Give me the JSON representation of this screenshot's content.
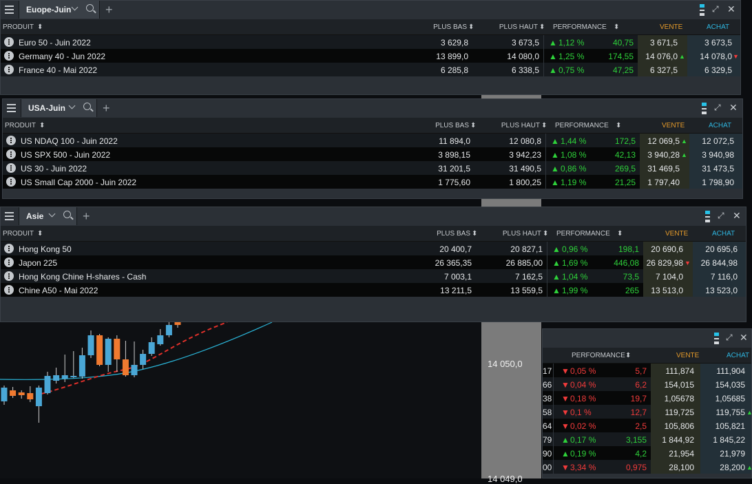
{
  "panels": {
    "europe": {
      "tab": "Euope-Juin",
      "headers": {
        "produit": "PRODUIT",
        "plus_bas": "PLUS BAS",
        "plus_haut": "PLUS HAUT",
        "performance": "PERFORMANCE",
        "vente": "VENTE",
        "achat": "ACHAT"
      },
      "rows": [
        {
          "name": "Euro 50 - Juin 2022",
          "plus_bas": "3 629,8",
          "plus_haut": "3 673,5",
          "perf": "1,12 %",
          "perf_dir": "up",
          "chg": "40,75",
          "vente": "3 671,5",
          "vente_mark": "",
          "achat": "3 673,5",
          "achat_mark": ""
        },
        {
          "name": "Germany 40 - Jun 2022",
          "plus_bas": "13 899,0",
          "plus_haut": "14 080,0",
          "perf": "1,25 %",
          "perf_dir": "up",
          "chg": "174,55",
          "vente": "14 076,0",
          "vente_mark": "up",
          "achat": "14 078,0",
          "achat_mark": "dn"
        },
        {
          "name": "France 40 - Mai 2022",
          "plus_bas": "6 285,8",
          "plus_haut": "6 338,5",
          "perf": "0,75 %",
          "perf_dir": "up",
          "chg": "47,25",
          "vente": "6 327,5",
          "vente_mark": "",
          "achat": "6 329,5",
          "achat_mark": ""
        }
      ]
    },
    "usa": {
      "tab": "USA-Juin",
      "headers": {
        "produit": "PRODUIT",
        "plus_bas": "PLUS BAS",
        "plus_haut": "PLUS HAUT",
        "performance": "PERFORMANCE",
        "vente": "VENTE",
        "achat": "ACHAT"
      },
      "rows": [
        {
          "name": "US NDAQ 100 - Juin 2022",
          "plus_bas": "11 894,0",
          "plus_haut": "12 080,8",
          "perf": "1,44 %",
          "perf_dir": "up",
          "chg": "172,5",
          "vente": "12 069,5",
          "vente_mark": "up",
          "achat": "12 072,5",
          "achat_mark": ""
        },
        {
          "name": "US SPX 500 - Juin 2022",
          "plus_bas": "3 898,15",
          "plus_haut": "3 942,23",
          "perf": "1,08 %",
          "perf_dir": "up",
          "chg": "42,13",
          "vente": "3 940,28",
          "vente_mark": "up",
          "achat": "3 940,98",
          "achat_mark": ""
        },
        {
          "name": "US 30 - Juin 2022",
          "plus_bas": "31 201,5",
          "plus_haut": "31 490,5",
          "perf": "0,86 %",
          "perf_dir": "up",
          "chg": "269,5",
          "vente": "31 469,5",
          "vente_mark": "",
          "achat": "31 473,5",
          "achat_mark": ""
        },
        {
          "name": "US Small Cap 2000 - Juin 2022",
          "plus_bas": "1 775,60",
          "plus_haut": "1 800,25",
          "perf": "1,19 %",
          "perf_dir": "up",
          "chg": "21,25",
          "vente": "1 797,40",
          "vente_mark": "",
          "achat": "1 798,90",
          "achat_mark": ""
        }
      ]
    },
    "asie": {
      "tab": "Asie",
      "headers": {
        "produit": "PRODUIT",
        "plus_bas": "PLUS BAS",
        "plus_haut": "PLUS HAUT",
        "performance": "PERFORMANCE",
        "vente": "VENTE",
        "achat": "ACHAT"
      },
      "rows": [
        {
          "name": "Hong Kong 50",
          "plus_bas": "20 400,7",
          "plus_haut": "20 827,1",
          "perf": "0,96 %",
          "perf_dir": "up",
          "chg": "198,1",
          "vente": "20 690,6",
          "vente_mark": "",
          "achat": "20 695,6",
          "achat_mark": ""
        },
        {
          "name": "Japon 225",
          "plus_bas": "26 365,35",
          "plus_haut": "26 885,00",
          "perf": "1,69 %",
          "perf_dir": "up",
          "chg": "446,08",
          "vente": "26 829,98",
          "vente_mark": "dn",
          "achat": "26 844,98",
          "achat_mark": ""
        },
        {
          "name": "Hong Kong Chine H-shares - Cash",
          "plus_bas": "7 003,1",
          "plus_haut": "7 162,5",
          "perf": "1,04 %",
          "perf_dir": "up",
          "chg": "73,5",
          "vente": "7 104,0",
          "vente_mark": "",
          "achat": "7 116,0",
          "achat_mark": ""
        },
        {
          "name": "Chine A50 - Mai 2022",
          "plus_bas": "13 211,5",
          "plus_haut": "13 559,5",
          "perf": "1,99 %",
          "perf_dir": "up",
          "chg": "265",
          "vente": "13 513,0",
          "vente_mark": "",
          "achat": "13 523,0",
          "achat_mark": ""
        }
      ]
    },
    "fx": {
      "headers": {
        "performance": "PERFORMANCE",
        "vente": "VENTE",
        "achat": "ACHAT"
      },
      "rows": [
        {
          "cut": "17",
          "perf": "0,05 %",
          "perf_dir": "dn",
          "chg": "5,7",
          "vente": "111,874",
          "achat": "111,904",
          "achat_mark": ""
        },
        {
          "cut": "66",
          "perf": "0,04 %",
          "perf_dir": "dn",
          "chg": "6,2",
          "vente": "154,015",
          "achat": "154,035",
          "achat_mark": ""
        },
        {
          "cut": "38",
          "perf": "0,18 %",
          "perf_dir": "dn",
          "chg": "19,7",
          "vente": "1,05678",
          "achat": "1,05685",
          "achat_mark": ""
        },
        {
          "cut": "58",
          "perf": "0,1 %",
          "perf_dir": "dn",
          "chg": "12,7",
          "vente": "119,725",
          "achat": "119,755",
          "achat_mark": "up"
        },
        {
          "cut": "64",
          "perf": "0,02 %",
          "perf_dir": "dn",
          "chg": "2,5",
          "vente": "105,806",
          "achat": "105,821",
          "achat_mark": ""
        },
        {
          "cut": "79",
          "perf": "0,17 %",
          "perf_dir": "up",
          "chg": "3,155",
          "vente": "1 844,92",
          "achat": "1 845,22",
          "achat_mark": ""
        },
        {
          "cut": "90",
          "perf": "0,19 %",
          "perf_dir": "up",
          "chg": "4,2",
          "vente": "21,954",
          "achat": "21,979",
          "achat_mark": ""
        },
        {
          "cut": "00",
          "perf": "3,34 %",
          "perf_dir": "dn",
          "chg": "0,975",
          "vente": "28,100",
          "achat": "28,200",
          "achat_mark": "up"
        }
      ]
    }
  },
  "chart": {
    "price_label": "14 050,0",
    "price_label_bottom": "14 049,0",
    "candles": [
      {
        "o": 583,
        "c": 563,
        "h": 560,
        "l": 588,
        "up": true
      },
      {
        "o": 567,
        "c": 575,
        "h": 562,
        "l": 578,
        "up": false
      },
      {
        "o": 570,
        "c": 574,
        "h": 567,
        "l": 579,
        "up": false
      },
      {
        "o": 571,
        "c": 580,
        "h": 561,
        "l": 584,
        "up": false
      },
      {
        "o": 590,
        "c": 563,
        "h": 560,
        "l": 614,
        "up": true
      },
      {
        "o": 571,
        "c": 546,
        "h": 540,
        "l": 573,
        "up": true
      },
      {
        "o": 553,
        "c": 545,
        "h": 534,
        "l": 557,
        "up": true
      },
      {
        "o": 550,
        "c": 545,
        "h": 515,
        "l": 555,
        "up": true
      },
      {
        "o": 547,
        "c": 546,
        "h": 510,
        "l": 549,
        "up": true
      },
      {
        "o": 547,
        "c": 516,
        "h": 505,
        "l": 550,
        "up": true
      },
      {
        "o": 516,
        "c": 487,
        "h": 480,
        "l": 520,
        "up": true
      },
      {
        "o": 487,
        "c": 530,
        "h": 485,
        "l": 532,
        "up": false
      },
      {
        "o": 530,
        "c": 492,
        "h": 490,
        "l": 540,
        "up": true
      },
      {
        "o": 492,
        "c": 522,
        "h": 487,
        "l": 540,
        "up": false
      },
      {
        "o": 522,
        "c": 545,
        "h": 495,
        "l": 547,
        "up": false
      },
      {
        "o": 545,
        "c": 530,
        "h": 496,
        "l": 548,
        "up": true
      },
      {
        "o": 530,
        "c": 514,
        "h": 508,
        "l": 536,
        "up": true
      },
      {
        "o": 514,
        "c": 497,
        "h": 490,
        "l": 517,
        "up": true
      },
      {
        "o": 500,
        "c": 487,
        "h": 478,
        "l": 502,
        "up": true
      },
      {
        "o": 487,
        "c": 472,
        "h": 466,
        "l": 490,
        "up": true
      },
      {
        "o": 472,
        "c": 468,
        "h": 464,
        "l": 476,
        "up": false
      }
    ]
  },
  "colors": {
    "up": "#2ed13a",
    "down": "#f23b3b",
    "vente": "#e49a2a",
    "achat": "#2fb6e0"
  }
}
